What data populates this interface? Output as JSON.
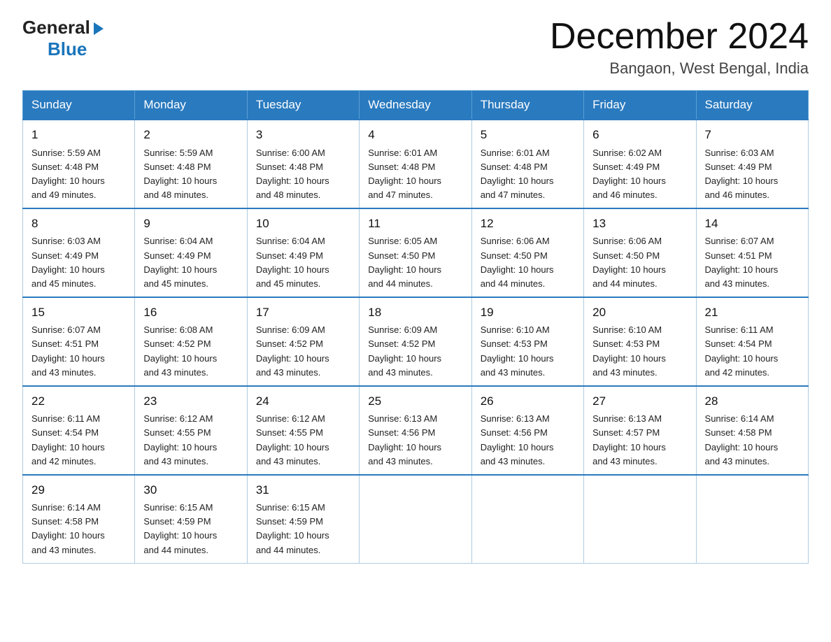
{
  "header": {
    "logo_general": "General",
    "logo_blue": "Blue",
    "month_title": "December 2024",
    "location": "Bangaon, West Bengal, India"
  },
  "days_of_week": [
    "Sunday",
    "Monday",
    "Tuesday",
    "Wednesday",
    "Thursday",
    "Friday",
    "Saturday"
  ],
  "weeks": [
    [
      {
        "day": "1",
        "info": "Sunrise: 5:59 AM\nSunset: 4:48 PM\nDaylight: 10 hours\nand 49 minutes."
      },
      {
        "day": "2",
        "info": "Sunrise: 5:59 AM\nSunset: 4:48 PM\nDaylight: 10 hours\nand 48 minutes."
      },
      {
        "day": "3",
        "info": "Sunrise: 6:00 AM\nSunset: 4:48 PM\nDaylight: 10 hours\nand 48 minutes."
      },
      {
        "day": "4",
        "info": "Sunrise: 6:01 AM\nSunset: 4:48 PM\nDaylight: 10 hours\nand 47 minutes."
      },
      {
        "day": "5",
        "info": "Sunrise: 6:01 AM\nSunset: 4:48 PM\nDaylight: 10 hours\nand 47 minutes."
      },
      {
        "day": "6",
        "info": "Sunrise: 6:02 AM\nSunset: 4:49 PM\nDaylight: 10 hours\nand 46 minutes."
      },
      {
        "day": "7",
        "info": "Sunrise: 6:03 AM\nSunset: 4:49 PM\nDaylight: 10 hours\nand 46 minutes."
      }
    ],
    [
      {
        "day": "8",
        "info": "Sunrise: 6:03 AM\nSunset: 4:49 PM\nDaylight: 10 hours\nand 45 minutes."
      },
      {
        "day": "9",
        "info": "Sunrise: 6:04 AM\nSunset: 4:49 PM\nDaylight: 10 hours\nand 45 minutes."
      },
      {
        "day": "10",
        "info": "Sunrise: 6:04 AM\nSunset: 4:49 PM\nDaylight: 10 hours\nand 45 minutes."
      },
      {
        "day": "11",
        "info": "Sunrise: 6:05 AM\nSunset: 4:50 PM\nDaylight: 10 hours\nand 44 minutes."
      },
      {
        "day": "12",
        "info": "Sunrise: 6:06 AM\nSunset: 4:50 PM\nDaylight: 10 hours\nand 44 minutes."
      },
      {
        "day": "13",
        "info": "Sunrise: 6:06 AM\nSunset: 4:50 PM\nDaylight: 10 hours\nand 44 minutes."
      },
      {
        "day": "14",
        "info": "Sunrise: 6:07 AM\nSunset: 4:51 PM\nDaylight: 10 hours\nand 43 minutes."
      }
    ],
    [
      {
        "day": "15",
        "info": "Sunrise: 6:07 AM\nSunset: 4:51 PM\nDaylight: 10 hours\nand 43 minutes."
      },
      {
        "day": "16",
        "info": "Sunrise: 6:08 AM\nSunset: 4:52 PM\nDaylight: 10 hours\nand 43 minutes."
      },
      {
        "day": "17",
        "info": "Sunrise: 6:09 AM\nSunset: 4:52 PM\nDaylight: 10 hours\nand 43 minutes."
      },
      {
        "day": "18",
        "info": "Sunrise: 6:09 AM\nSunset: 4:52 PM\nDaylight: 10 hours\nand 43 minutes."
      },
      {
        "day": "19",
        "info": "Sunrise: 6:10 AM\nSunset: 4:53 PM\nDaylight: 10 hours\nand 43 minutes."
      },
      {
        "day": "20",
        "info": "Sunrise: 6:10 AM\nSunset: 4:53 PM\nDaylight: 10 hours\nand 43 minutes."
      },
      {
        "day": "21",
        "info": "Sunrise: 6:11 AM\nSunset: 4:54 PM\nDaylight: 10 hours\nand 42 minutes."
      }
    ],
    [
      {
        "day": "22",
        "info": "Sunrise: 6:11 AM\nSunset: 4:54 PM\nDaylight: 10 hours\nand 42 minutes."
      },
      {
        "day": "23",
        "info": "Sunrise: 6:12 AM\nSunset: 4:55 PM\nDaylight: 10 hours\nand 43 minutes."
      },
      {
        "day": "24",
        "info": "Sunrise: 6:12 AM\nSunset: 4:55 PM\nDaylight: 10 hours\nand 43 minutes."
      },
      {
        "day": "25",
        "info": "Sunrise: 6:13 AM\nSunset: 4:56 PM\nDaylight: 10 hours\nand 43 minutes."
      },
      {
        "day": "26",
        "info": "Sunrise: 6:13 AM\nSunset: 4:56 PM\nDaylight: 10 hours\nand 43 minutes."
      },
      {
        "day": "27",
        "info": "Sunrise: 6:13 AM\nSunset: 4:57 PM\nDaylight: 10 hours\nand 43 minutes."
      },
      {
        "day": "28",
        "info": "Sunrise: 6:14 AM\nSunset: 4:58 PM\nDaylight: 10 hours\nand 43 minutes."
      }
    ],
    [
      {
        "day": "29",
        "info": "Sunrise: 6:14 AM\nSunset: 4:58 PM\nDaylight: 10 hours\nand 43 minutes."
      },
      {
        "day": "30",
        "info": "Sunrise: 6:15 AM\nSunset: 4:59 PM\nDaylight: 10 hours\nand 44 minutes."
      },
      {
        "day": "31",
        "info": "Sunrise: 6:15 AM\nSunset: 4:59 PM\nDaylight: 10 hours\nand 44 minutes."
      },
      null,
      null,
      null,
      null
    ]
  ]
}
